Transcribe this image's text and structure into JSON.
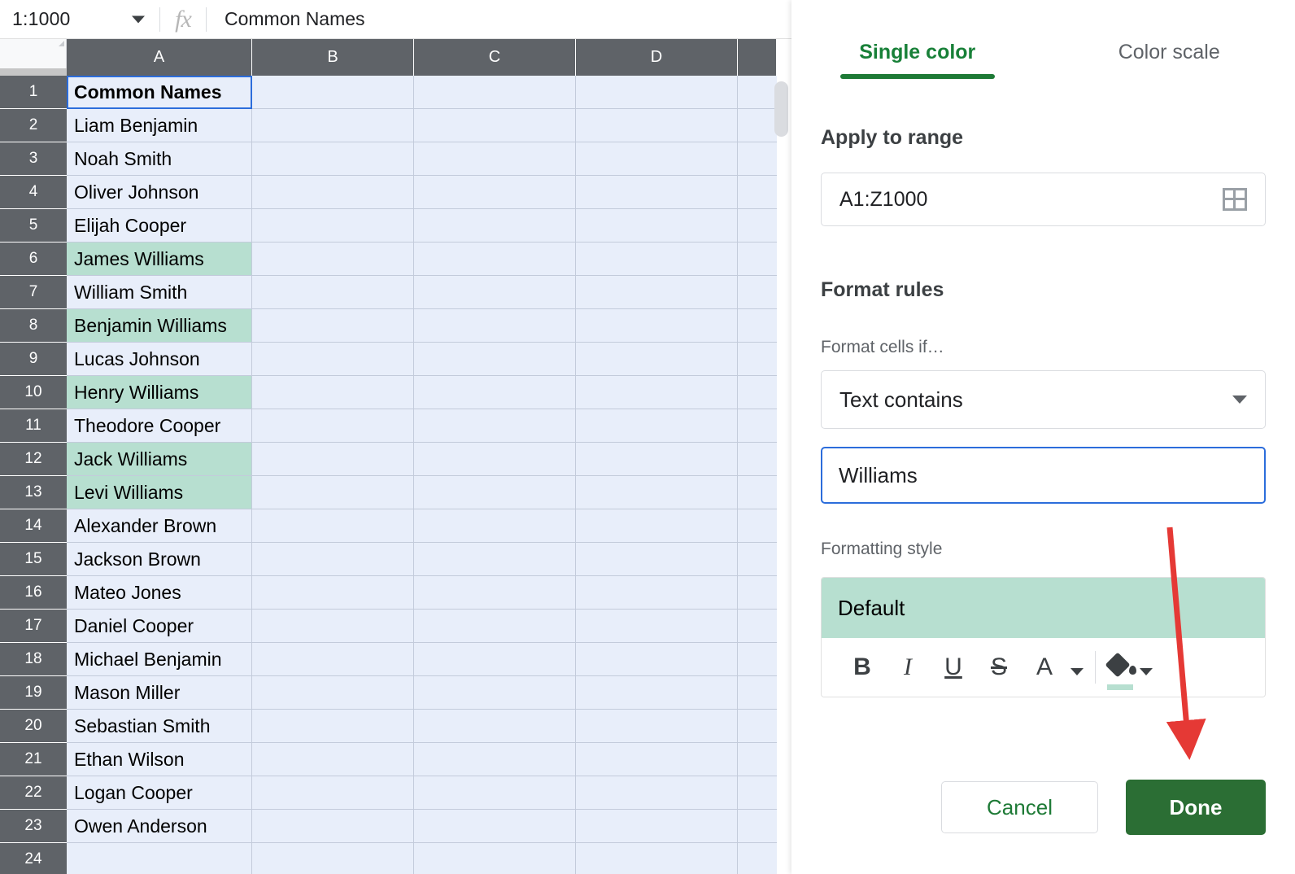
{
  "formula_bar": {
    "name_box": "1:1000",
    "fx_icon": "function-icon",
    "formula_value": "Common Names"
  },
  "grid": {
    "column_headers": [
      "A",
      "B",
      "C",
      "D",
      ""
    ],
    "rows": [
      {
        "num": "1",
        "a": "Common Names",
        "highlight": false,
        "bold": true,
        "active": true
      },
      {
        "num": "2",
        "a": "Liam Benjamin",
        "highlight": false,
        "bold": false,
        "active": false
      },
      {
        "num": "3",
        "a": "Noah Smith",
        "highlight": false,
        "bold": false,
        "active": false
      },
      {
        "num": "4",
        "a": "Oliver Johnson",
        "highlight": false,
        "bold": false,
        "active": false
      },
      {
        "num": "5",
        "a": "Elijah Cooper",
        "highlight": false,
        "bold": false,
        "active": false
      },
      {
        "num": "6",
        "a": "James Williams",
        "highlight": true,
        "bold": false,
        "active": false
      },
      {
        "num": "7",
        "a": "William Smith",
        "highlight": false,
        "bold": false,
        "active": false
      },
      {
        "num": "8",
        "a": "Benjamin Williams",
        "highlight": true,
        "bold": false,
        "active": false
      },
      {
        "num": "9",
        "a": "Lucas Johnson",
        "highlight": false,
        "bold": false,
        "active": false
      },
      {
        "num": "10",
        "a": "Henry Williams",
        "highlight": true,
        "bold": false,
        "active": false
      },
      {
        "num": "11",
        "a": "Theodore Cooper",
        "highlight": false,
        "bold": false,
        "active": false
      },
      {
        "num": "12",
        "a": "Jack Williams",
        "highlight": true,
        "bold": false,
        "active": false
      },
      {
        "num": "13",
        "a": "Levi Williams",
        "highlight": true,
        "bold": false,
        "active": false
      },
      {
        "num": "14",
        "a": "Alexander Brown",
        "highlight": false,
        "bold": false,
        "active": false
      },
      {
        "num": "15",
        "a": "Jackson Brown",
        "highlight": false,
        "bold": false,
        "active": false
      },
      {
        "num": "16",
        "a": "Mateo Jones",
        "highlight": false,
        "bold": false,
        "active": false
      },
      {
        "num": "17",
        "a": "Daniel Cooper",
        "highlight": false,
        "bold": false,
        "active": false
      },
      {
        "num": "18",
        "a": "Michael Benjamin",
        "highlight": false,
        "bold": false,
        "active": false
      },
      {
        "num": "19",
        "a": "Mason Miller",
        "highlight": false,
        "bold": false,
        "active": false
      },
      {
        "num": "20",
        "a": "Sebastian Smith",
        "highlight": false,
        "bold": false,
        "active": false
      },
      {
        "num": "21",
        "a": "Ethan Wilson",
        "highlight": false,
        "bold": false,
        "active": false
      },
      {
        "num": "22",
        "a": "Logan Cooper",
        "highlight": false,
        "bold": false,
        "active": false
      },
      {
        "num": "23",
        "a": "Owen Anderson",
        "highlight": false,
        "bold": false,
        "active": false
      },
      {
        "num": "24",
        "a": "",
        "highlight": false,
        "bold": false,
        "active": false
      }
    ]
  },
  "panel": {
    "tabs": [
      {
        "label": "Single color",
        "active": true
      },
      {
        "label": "Color scale",
        "active": false
      }
    ],
    "apply_to_range": {
      "title": "Apply to range",
      "value": "A1:Z1000",
      "picker_icon": "grid-select-icon"
    },
    "format_rules": {
      "title": "Format rules",
      "condition_label": "Format cells if…",
      "condition_value": "Text contains",
      "condition_caret_icon": "chevron-down-icon",
      "criteria_value": "Williams"
    },
    "formatting_style": {
      "title": "Formatting style",
      "preview_text": "Default",
      "toolbar": [
        {
          "name": "bold",
          "glyph": "B"
        },
        {
          "name": "italic",
          "glyph": "I"
        },
        {
          "name": "underline",
          "glyph": "U"
        },
        {
          "name": "strikethrough",
          "glyph": "S"
        },
        {
          "name": "text-color",
          "glyph": "A"
        },
        {
          "name": "fill-color",
          "glyph": ""
        }
      ]
    },
    "buttons": {
      "cancel": "Cancel",
      "done": "Done"
    }
  },
  "colors": {
    "highlight_green": "#b7dfd0",
    "accent_green": "#1e7a36",
    "done_button_green": "#2b6e34",
    "selection_blue": "#2c6ddb",
    "selected_cell_tint": "#e8eefa",
    "header_gray": "#5f6368",
    "annotation_red": "#e53935"
  },
  "annotation": {
    "arrow_target": "done-button"
  }
}
